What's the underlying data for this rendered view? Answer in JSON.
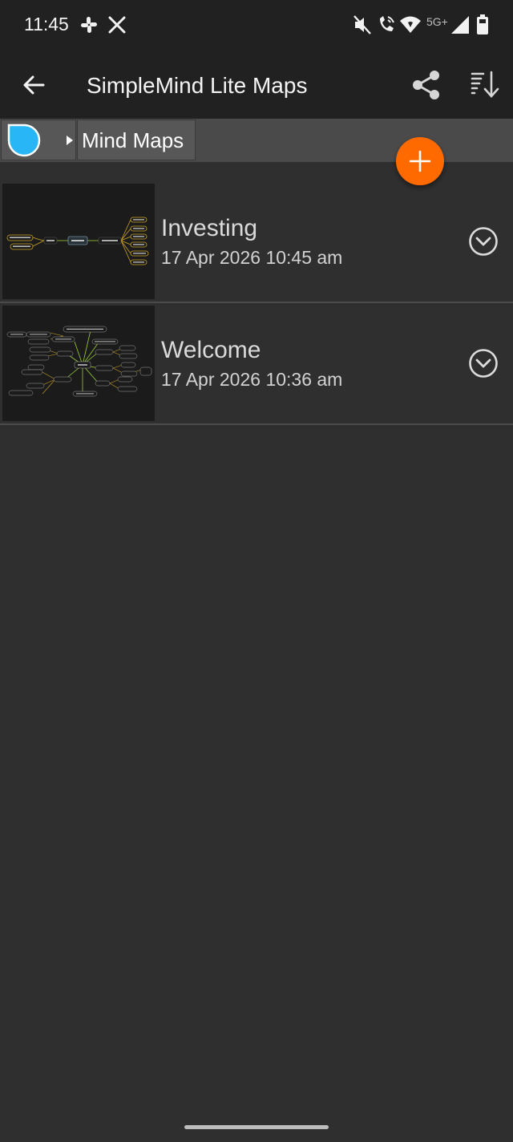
{
  "status_bar": {
    "time": "11:45",
    "left_icons": [
      "slack-icon",
      "x-icon"
    ],
    "right_icons": [
      "mute-icon",
      "wifi-calling-icon",
      "wifi-icon",
      "cellular-signal-icon",
      "battery-icon"
    ],
    "network": "5G+"
  },
  "app_bar": {
    "title": "SimpleMind Lite Maps",
    "back_icon": "arrow-back-icon",
    "share_icon": "share-icon",
    "sort_icon": "sort-icon"
  },
  "breadcrumb": {
    "root_icon": "simplemind-logo-icon",
    "separator_icon": "caret-right-icon",
    "current": "Mind Maps"
  },
  "fab": {
    "icon": "plus-icon",
    "color": "#ff6a00"
  },
  "maps": [
    {
      "name": "Investing",
      "date": "17 Apr 2026 10:45 am",
      "action_icon": "chevron-down-circle-icon"
    },
    {
      "name": "Welcome",
      "date": "17 Apr 2026 10:36 am",
      "action_icon": "chevron-down-circle-icon"
    }
  ],
  "colors": {
    "background": "#2f2f2f",
    "app_bar": "#212121",
    "breadcrumb": "#4a4a4a",
    "accent": "#ff6a00",
    "logo_blue": "#29b6f6"
  }
}
